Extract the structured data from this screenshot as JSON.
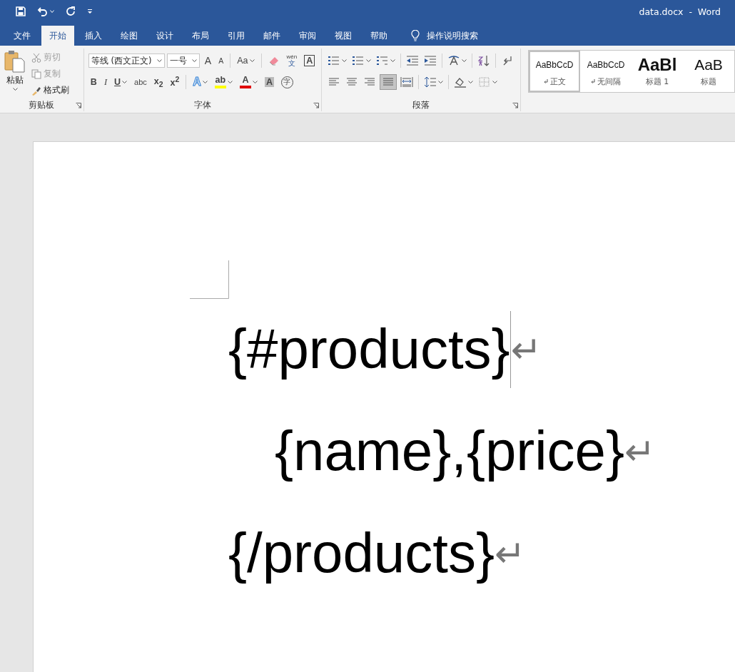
{
  "quick_access": [
    {
      "kind": "save"
    },
    {
      "kind": "undo",
      "dropdown": true
    },
    {
      "kind": "redo",
      "dropdown": false
    },
    {
      "kind": "customize"
    }
  ],
  "window": {
    "title": "data.docx  -  Word"
  },
  "tabs": [
    {
      "label": "文件",
      "selected": false
    },
    {
      "label": "开始",
      "selected": true
    },
    {
      "label": "插入",
      "selected": false
    },
    {
      "label": "绘图",
      "selected": false
    },
    {
      "label": "设计",
      "selected": false
    },
    {
      "label": "布局",
      "selected": false
    },
    {
      "label": "引用",
      "selected": false
    },
    {
      "label": "邮件",
      "selected": false
    },
    {
      "label": "审阅",
      "selected": false
    },
    {
      "label": "视图",
      "selected": false
    },
    {
      "label": "帮助",
      "selected": false
    }
  ],
  "tell_me": {
    "placeholder": "操作说明搜索"
  },
  "clipboard": {
    "label": "剪贴板",
    "paste": "粘贴",
    "items": [
      {
        "kind": "scissors",
        "label": "剪切",
        "disabled": true
      },
      {
        "kind": "copy",
        "label": "复制",
        "disabled": true
      },
      {
        "kind": "brush",
        "label": "格式刷",
        "disabled": false
      }
    ]
  },
  "font": {
    "label": "字体",
    "font_name": "等线 (西文正文)",
    "font_size": "一号",
    "row1": [
      {
        "kind": "grow",
        "label": "A",
        "dropdown": false
      },
      {
        "kind": "shrink",
        "label": "A",
        "dropdown": false
      },
      {
        "kind": "case",
        "label": "Aa",
        "dropdown": true
      },
      {
        "kind": "eraser",
        "dropdown": false
      },
      {
        "kind": "phonetic",
        "label": "wén",
        "sub": "文",
        "dropdown": false
      },
      {
        "kind": "border",
        "label": "A",
        "dropdown": false
      }
    ],
    "row2": [
      {
        "kind": "bold",
        "label": "B",
        "dropdown": false
      },
      {
        "kind": "italic",
        "label": "I",
        "dropdown": false
      },
      {
        "kind": "underline",
        "label": "U",
        "dropdown": true
      },
      {
        "kind": "strike",
        "label": "abc",
        "dropdown": false
      },
      {
        "kind": "script",
        "label": "x$_{2}$",
        "dropdown": false
      },
      {
        "kind": "script",
        "label": "x$^{2}$",
        "dropdown": false
      },
      {
        "kind": "effects",
        "label": "A",
        "dropdown": true
      },
      {
        "kind": "highlight",
        "label": "ab",
        "color": "#ffff00",
        "dropdown": true
      },
      {
        "kind": "fontcolor",
        "label": "A",
        "color": "#e00000",
        "dropdown": true
      },
      {
        "kind": "shade",
        "label": "A",
        "dropdown": false
      },
      {
        "kind": "enclose",
        "label": "字",
        "dropdown": false
      }
    ]
  },
  "paragraph": {
    "label": "段落",
    "row1": [
      {
        "kind": "bullet-list",
        "dropdown": true,
        "selected": false
      },
      {
        "kind": "numbered-list",
        "dropdown": true,
        "selected": false
      },
      {
        "kind": "multilevel-list",
        "dropdown": true,
        "selected": false
      },
      {
        "kind": "outdent",
        "dropdown": false,
        "selected": false
      },
      {
        "kind": "indent",
        "dropdown": false,
        "selected": false
      },
      {
        "kind": "text-direction",
        "dropdown": true,
        "selected": false
      },
      {
        "kind": "sort",
        "dropdown": false,
        "selected": false
      },
      {
        "kind": "return-arrow",
        "dropdown": false,
        "selected": false
      }
    ],
    "row2": [
      {
        "kind": "align-left",
        "dropdown": false,
        "selected": false
      },
      {
        "kind": "align-center",
        "dropdown": false,
        "selected": false
      },
      {
        "kind": "align-right",
        "dropdown": false,
        "selected": false
      },
      {
        "kind": "justify",
        "dropdown": false,
        "selected": true
      },
      {
        "kind": "distribute",
        "dropdown": false,
        "selected": false
      },
      {
        "kind": "line-spacing",
        "dropdown": true,
        "selected": false
      },
      {
        "kind": "paint-bucket",
        "dropdown": true,
        "selected": false
      },
      {
        "kind": "borders",
        "dropdown": true,
        "selected": false
      }
    ]
  },
  "styles": [
    {
      "preview": "AaBbCcD",
      "name": "正文",
      "kind": "normal",
      "selected": true
    },
    {
      "preview": "AaBbCcD",
      "name": "无间隔",
      "kind": "normal",
      "selected": false
    },
    {
      "preview": "AaBl",
      "name": "标题 1",
      "kind": "heading",
      "selected": false
    },
    {
      "preview": "AaB",
      "name": "标题",
      "kind": "heading2",
      "selected": false
    }
  ],
  "document": {
    "paragraphs": [
      {
        "text": "{#products}",
        "mark": "↵",
        "cursor": true,
        "children": [
          {
            "text": "{name},{price}",
            "mark": "↵",
            "cursor": false
          }
        ]
      },
      {
        "text": "{/products}",
        "mark": "↵",
        "cursor": false
      }
    ]
  }
}
